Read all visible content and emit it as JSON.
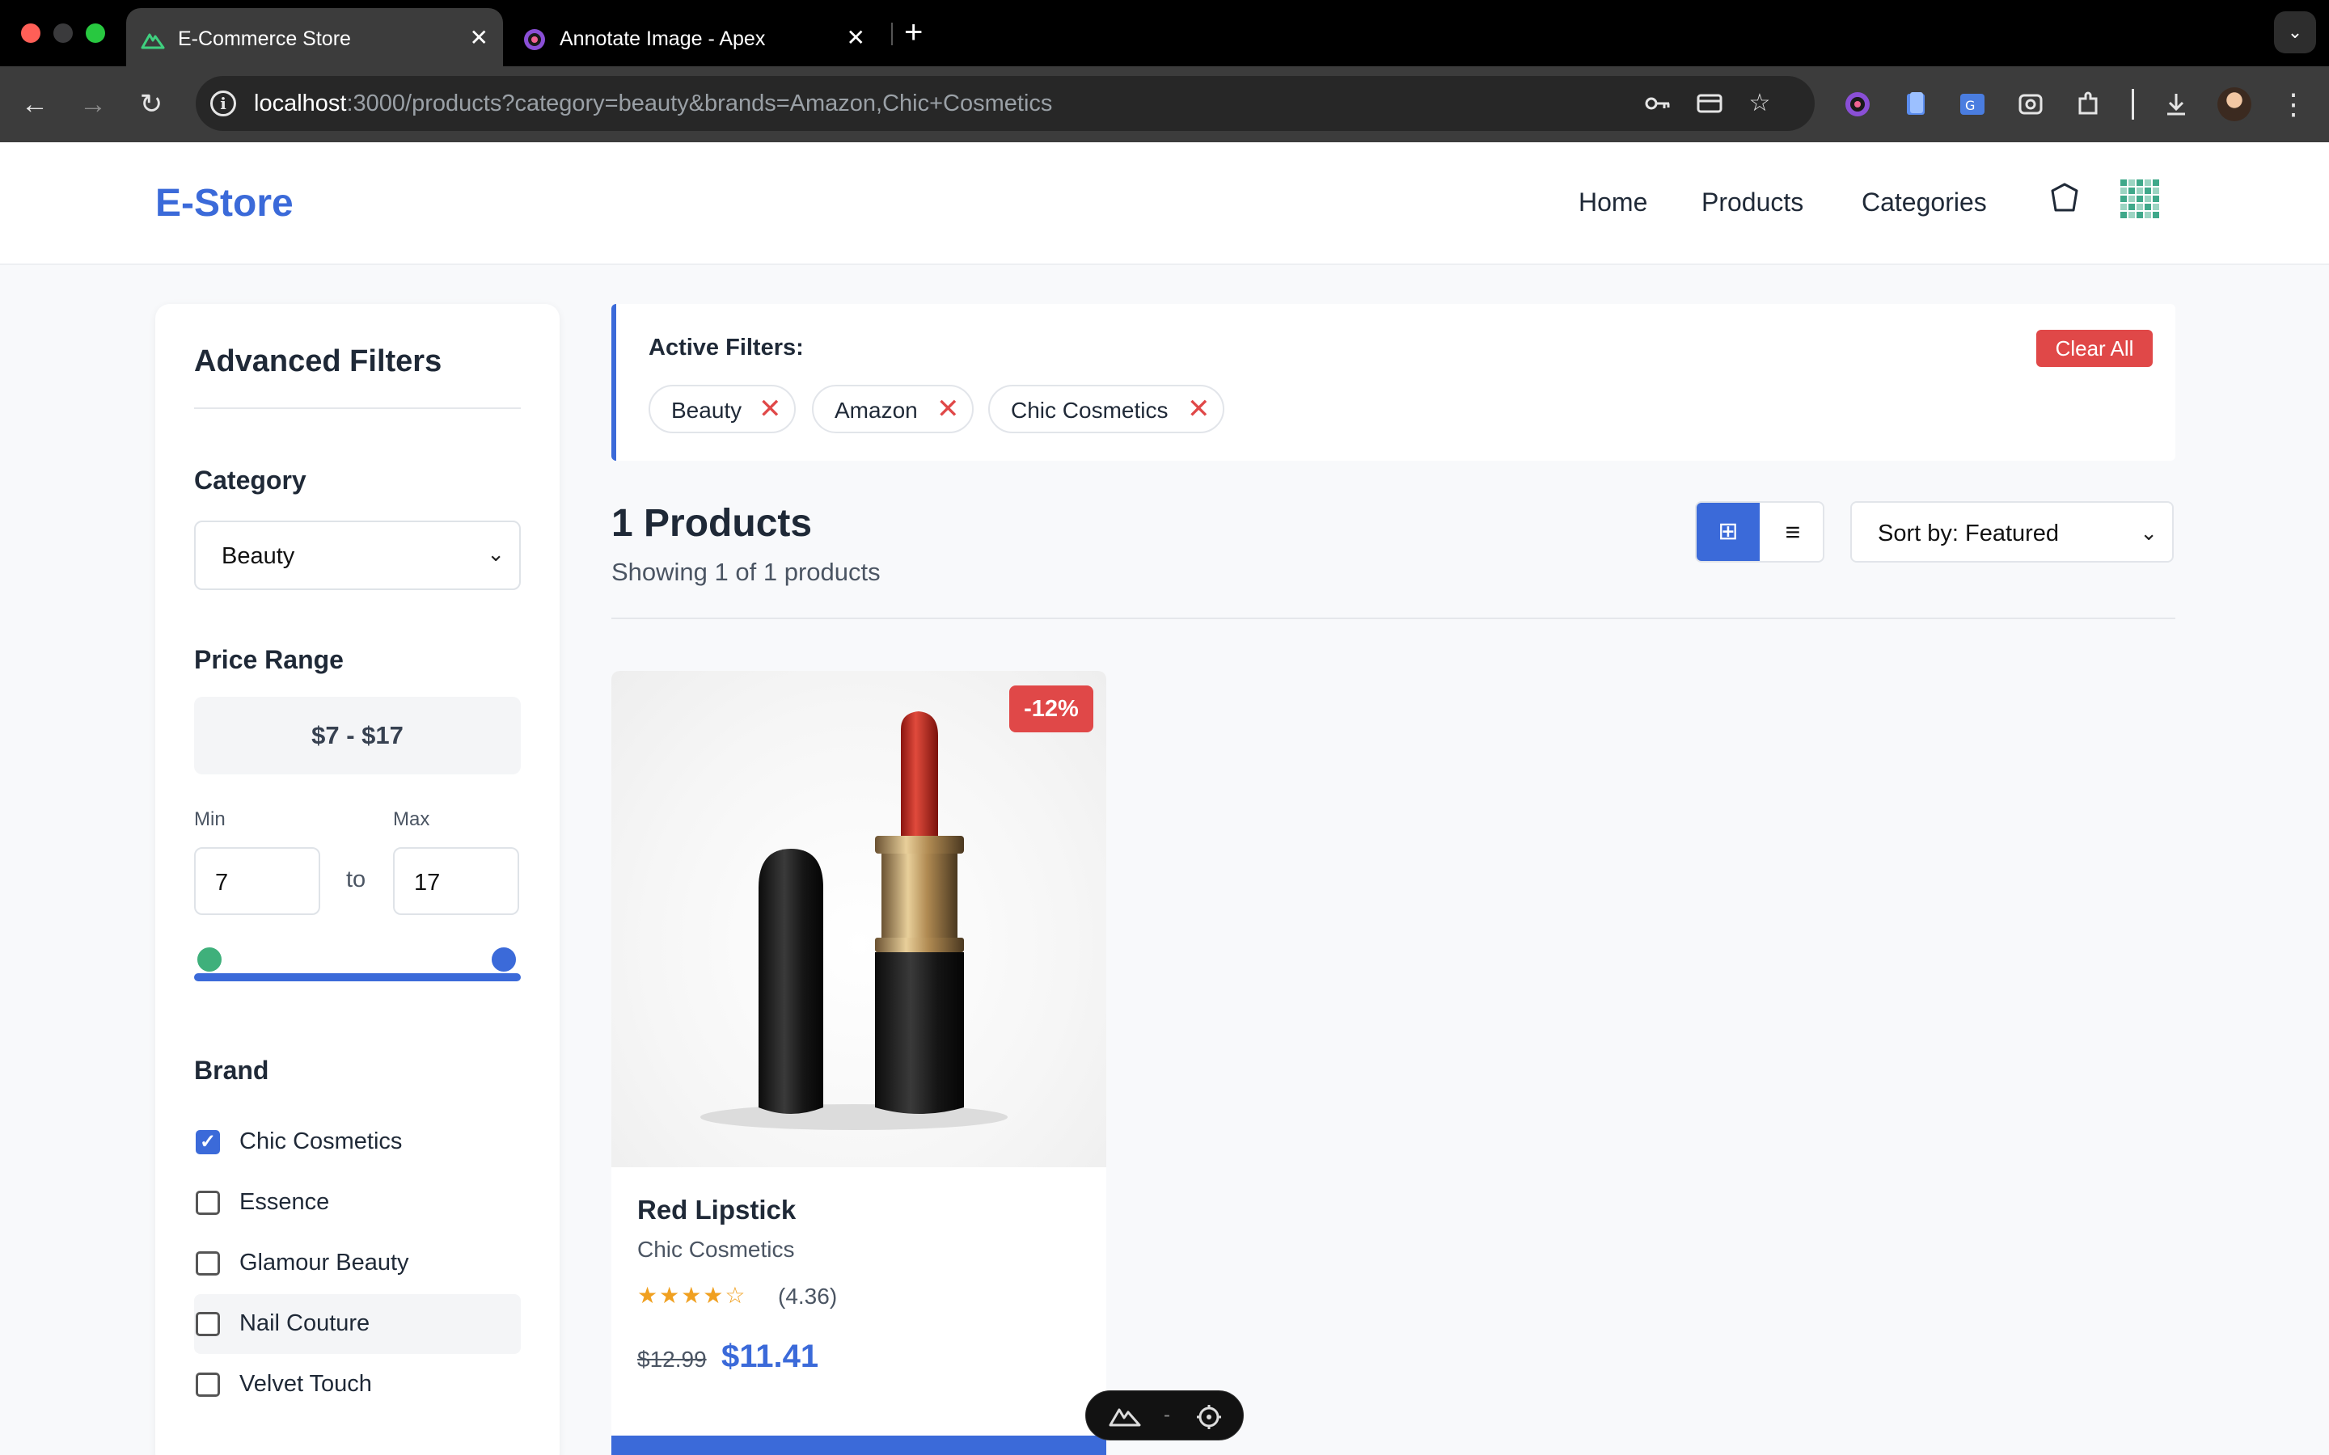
{
  "browser": {
    "tabs": [
      {
        "title": "E-Commerce Store",
        "active": true,
        "icon": "nuxt-icon"
      },
      {
        "title": "Annotate Image - Apex",
        "active": false,
        "icon": "apex-icon"
      }
    ],
    "url": {
      "host": "localhost",
      "rest": ":3000/products?category=beauty&brands=Amazon,Chic+Cosmetics"
    }
  },
  "header": {
    "logo": "E-Store",
    "nav": [
      "Home",
      "Products",
      "Categories"
    ],
    "icons": [
      "cart-icon",
      "profile-grid-icon"
    ]
  },
  "sidebar": {
    "title": "Advanced Filters",
    "category": {
      "heading": "Category",
      "selected": "Beauty"
    },
    "price": {
      "heading": "Price Range",
      "display": "$7 - $17",
      "min_label": "Min",
      "max_label": "Max",
      "min_value": "7",
      "max_value": "17",
      "to_label": "to"
    },
    "brand": {
      "heading": "Brand",
      "items": [
        {
          "label": "Chic Cosmetics",
          "checked": true
        },
        {
          "label": "Essence",
          "checked": false
        },
        {
          "label": "Glamour Beauty",
          "checked": false
        },
        {
          "label": "Nail Couture",
          "checked": false
        },
        {
          "label": "Velvet Touch",
          "checked": false
        }
      ]
    }
  },
  "active_filters": {
    "title": "Active Filters:",
    "clear_label": "Clear All",
    "chips": [
      "Beauty",
      "Amazon",
      "Chic Cosmetics"
    ],
    "remove_glyph": "✕"
  },
  "results": {
    "count_title": "1 Products",
    "showing": "Showing 1 of 1 products",
    "sort": "Sort by: Featured",
    "view": "grid"
  },
  "product": {
    "name": "Red Lipstick",
    "brand": "Chic Cosmetics",
    "stars": "★★★★☆",
    "rating": "(4.36)",
    "old_price": "$12.99",
    "price": "$11.41",
    "discount": "-12%"
  },
  "dev_toolbar": {
    "separator": "-"
  },
  "colors": {
    "accent": "#3b6ad9",
    "danger": "#e04848",
    "star": "#f0a020"
  }
}
